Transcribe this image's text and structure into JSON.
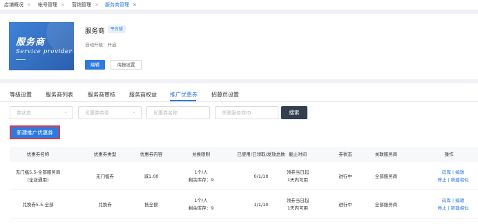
{
  "top_tabs": [
    {
      "label": "店铺概况",
      "close": "×"
    },
    {
      "label": "帐号管理",
      "close": "×"
    },
    {
      "label": "营销管理",
      "close": "×"
    },
    {
      "label": "服务商管理",
      "close": "×"
    }
  ],
  "provider": {
    "banner_cn": "服务商",
    "banner_en": "Service provider",
    "name": "服务商",
    "badge": "平台版",
    "auto_upgrade": "自动升级：开启",
    "edit_button": "编辑",
    "sea_button": "海报设置"
  },
  "sub_tabs": [
    "等级设置",
    "服务商列表",
    "服务商审核",
    "服务商权益",
    "推广优惠券",
    "招募页设置"
  ],
  "active_sub_tab": "推广优惠券",
  "filters": {
    "status_placeholder": "券状态",
    "type_placeholder": "优惠券类型",
    "name_placeholder": "优惠券名称",
    "provider_id_placeholder": "关联服务商ID",
    "search_button": "搜索"
  },
  "new_coupon_button": "新建推广优惠券",
  "table": {
    "headers": [
      "优惠券名称",
      "优惠券类型",
      "优惠券内容",
      "兑换限制",
      "已使用/已领取/发放总数",
      "截止时间",
      "券状态",
      "关联服务商",
      "操作"
    ],
    "rows": [
      {
        "name": [
          "无门槛5.5-全部服务商",
          "(全店通用)"
        ],
        "type": "无门槛券",
        "content": "减1.00",
        "limit": [
          "1个/人",
          "剩余库存：9"
        ],
        "usage": "0/1/10",
        "deadline": [
          "领券当日起",
          "1天内可用"
        ],
        "status": "进行中",
        "provider": "全部服务商",
        "ops": [
          "码库",
          "编辑",
          "停止",
          "新建相似"
        ]
      },
      {
        "name": [
          "兑换券5.5-全部"
        ],
        "type": "兑换券",
        "content": "抵全额",
        "limit": [
          "1个/人",
          "剩余库存：9"
        ],
        "usage": "1/1/10",
        "deadline": [
          "领券当日起",
          "1天内可用"
        ],
        "status": "进行中",
        "provider": "全部服务商",
        "ops": [
          "码库",
          "编辑",
          "停止",
          "新建相似"
        ]
      }
    ]
  },
  "colors": {
    "accent": "#2d7be0",
    "highlight_border": "#e8343f",
    "search_button": "#333f4d"
  }
}
